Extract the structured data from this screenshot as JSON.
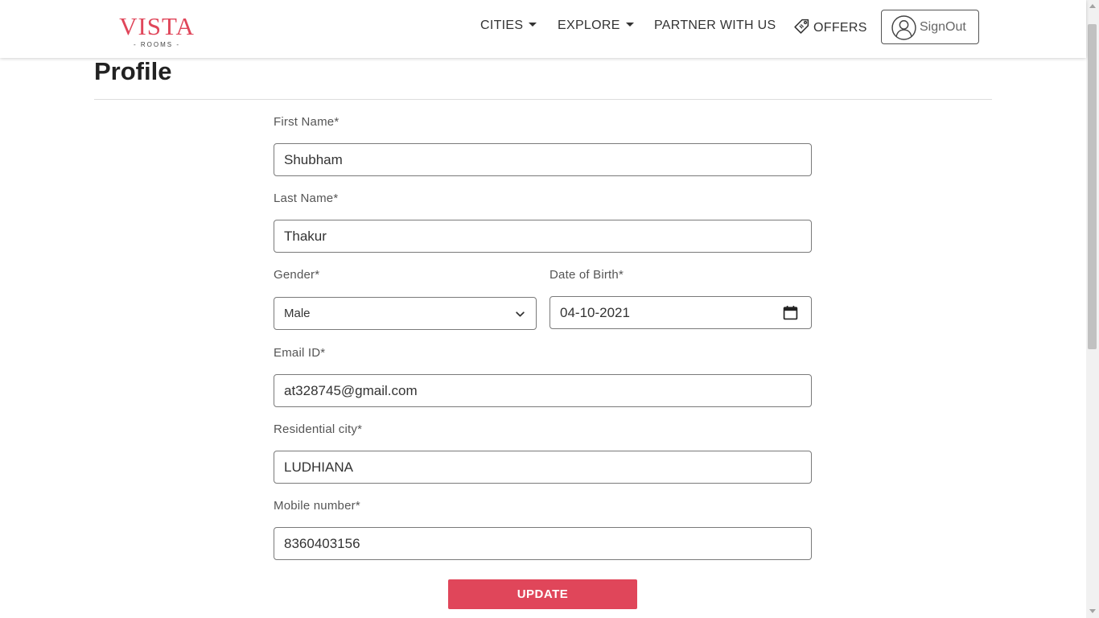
{
  "brand": {
    "name": "VISTA",
    "tagline": "ROOMS",
    "accent_color": "#e0465a"
  },
  "nav": {
    "cities": "CITIES",
    "explore": "EXPLORE",
    "partner": "PARTNER WITH US",
    "offers": "OFFERS",
    "signout": "SignOut"
  },
  "page": {
    "title": "Profile"
  },
  "form": {
    "first_name": {
      "label": "First Name*",
      "value": "Shubham"
    },
    "last_name": {
      "label": "Last Name*",
      "value": "Thakur"
    },
    "gender": {
      "label": "Gender*",
      "value": "Male"
    },
    "dob": {
      "label": "Date of Birth*",
      "value": "04-10-2021"
    },
    "email": {
      "label": "Email ID*",
      "value": "at328745@gmail.com"
    },
    "city": {
      "label": "Residential city*",
      "value": "LUDHIANA"
    },
    "mobile": {
      "label": "Mobile number*",
      "value": "8360403156"
    },
    "submit": "UPDATE"
  },
  "icons": {
    "dropdown": "caret-down-icon",
    "offers": "tag-icon",
    "user": "user-circle-icon",
    "select": "chevron-down-icon",
    "date": "calendar-icon"
  }
}
